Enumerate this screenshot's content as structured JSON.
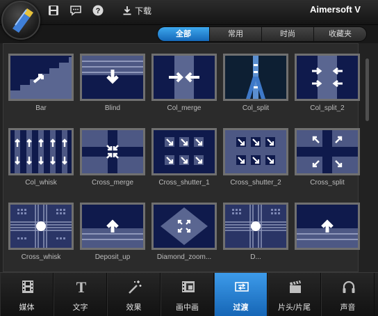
{
  "app": {
    "title": "Aimersoft V"
  },
  "toolbar": {
    "download_label": "下载"
  },
  "filters": [
    {
      "label": "全部",
      "active": true
    },
    {
      "label": "常用",
      "active": false
    },
    {
      "label": "时尚",
      "active": false
    },
    {
      "label": "收藏夹",
      "active": false
    }
  ],
  "transitions": [
    {
      "label": "Bar"
    },
    {
      "label": "Blind"
    },
    {
      "label": "Col_merge"
    },
    {
      "label": "Col_split"
    },
    {
      "label": "Col_split_2"
    },
    {
      "label": "Col_whisk"
    },
    {
      "label": "Cross_merge"
    },
    {
      "label": "Cross_shutter_1"
    },
    {
      "label": "Cross_shutter_2"
    },
    {
      "label": "Cross_split"
    },
    {
      "label": "Cross_whisk"
    },
    {
      "label": "Deposit_up"
    },
    {
      "label": "Diamond_zoom..."
    },
    {
      "label": "D..."
    },
    {
      "label": ""
    }
  ],
  "nav": [
    {
      "label": "媒体",
      "icon": "film-strip-icon"
    },
    {
      "label": "文字",
      "icon": "text-t-icon"
    },
    {
      "label": "效果",
      "icon": "magic-wand-icon"
    },
    {
      "label": "画中画",
      "icon": "picture-in-picture-icon"
    },
    {
      "label": "过渡",
      "icon": "transition-icon",
      "active": true
    },
    {
      "label": "片头/片尾",
      "icon": "clapperboard-icon"
    },
    {
      "label": "声音",
      "icon": "headphones-icon"
    }
  ],
  "colors": {
    "accent": "#1f7fd2",
    "tile_bg": "#0f1a4c",
    "tile_border": "#707070"
  }
}
